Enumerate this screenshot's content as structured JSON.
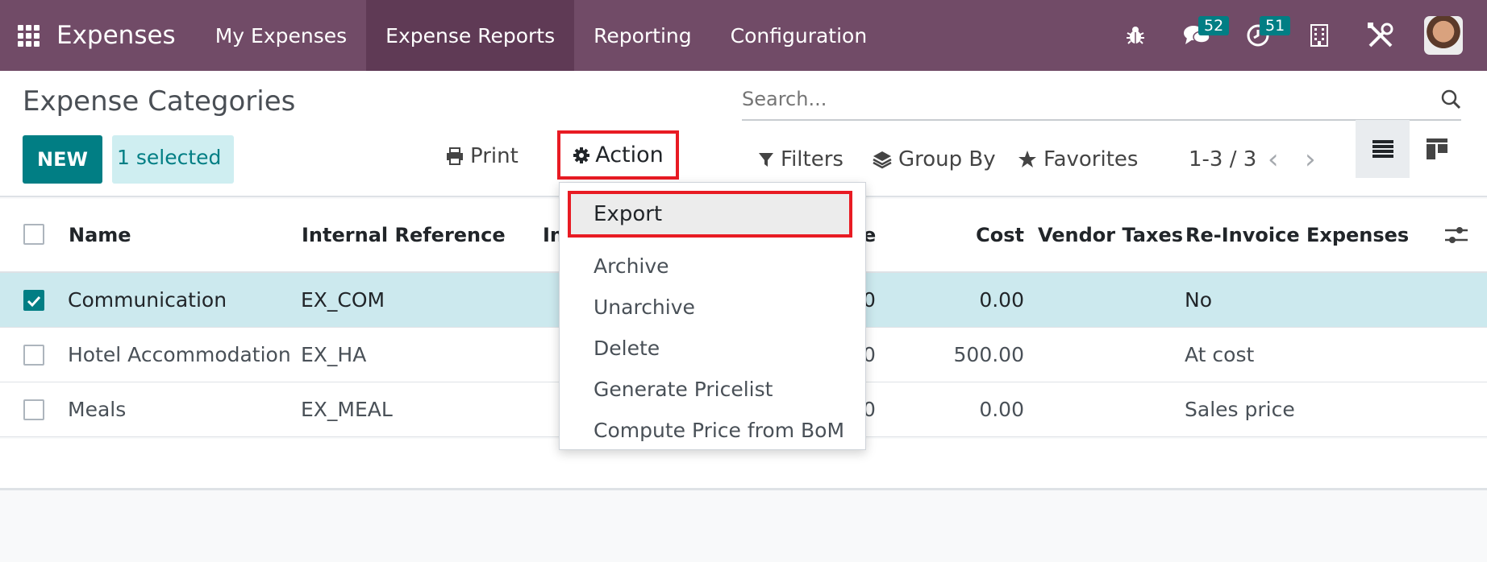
{
  "navbar": {
    "app_name": "Expenses",
    "menus": [
      "My Expenses",
      "Expense Reports",
      "Reporting",
      "Configuration"
    ],
    "messages_count": "52",
    "activities_count": "51",
    "colors": {
      "brand": "#714b67",
      "active": "#5f3a55",
      "badge": "#017e84"
    }
  },
  "control": {
    "title": "Expense Categories",
    "new_label": "NEW",
    "selected_label": "1 selected",
    "print_label": "Print",
    "action_label": "Action",
    "search_placeholder": "Search...",
    "filters_label": "Filters",
    "groupby_label": "Group By",
    "favorites_label": "Favorites",
    "pager": "1-3 / 3"
  },
  "table": {
    "headers": {
      "name": "Name",
      "internal_ref": "Internal Reference",
      "internal_ref_fragment": "In",
      "price_fragment": "e",
      "cost": "Cost",
      "vendor_taxes": "Vendor Taxes",
      "reinvoice": "Re-Invoice Expenses"
    },
    "rows": [
      {
        "name": "Communication",
        "ref": "EX_COM",
        "price_fragment": "0",
        "cost": "0.00",
        "reinvoice": "No",
        "checked": true
      },
      {
        "name": "Hotel Accommodation",
        "ref": "EX_HA",
        "price_fragment": "0",
        "cost": "500.00",
        "reinvoice": "At cost",
        "checked": false
      },
      {
        "name": "Meals",
        "ref": "EX_MEAL",
        "price_fragment": "0",
        "cost": "0.00",
        "reinvoice": "Sales price",
        "checked": false
      }
    ]
  },
  "action_menu": {
    "items": [
      "Export",
      "Archive",
      "Unarchive",
      "Delete",
      "Generate Pricelist",
      "Compute Price from BoM"
    ]
  }
}
